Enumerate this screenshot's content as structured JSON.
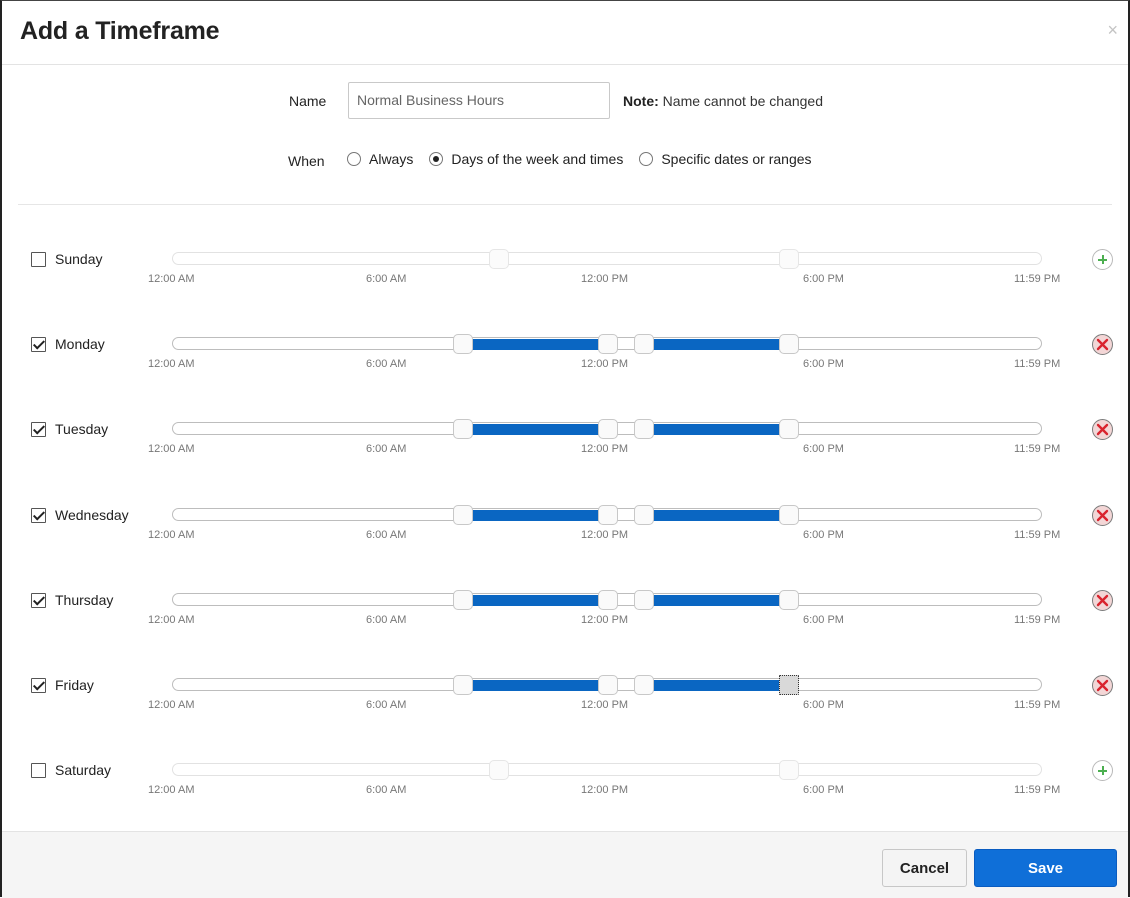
{
  "dialog": {
    "title": "Add a Timeframe",
    "close_glyph": "×"
  },
  "form": {
    "name_label": "Name",
    "name_value": "Normal Business Hours",
    "note_bold": "Note:",
    "note_text": " Name cannot be changed",
    "when_label": "When",
    "when_options": [
      {
        "label": "Always",
        "selected": false
      },
      {
        "label": "Days of the week and times",
        "selected": true
      },
      {
        "label": "Specific dates or ranges",
        "selected": false
      }
    ]
  },
  "tick_labels": [
    "12:00 AM",
    "6:00 AM",
    "12:00 PM",
    "6:00 PM",
    "11:59 PM"
  ],
  "days": [
    {
      "label": "Sunday",
      "checked": false,
      "action_icon": "add-icon",
      "ranges": []
    },
    {
      "label": "Monday",
      "checked": true,
      "action_icon": "remove-icon",
      "ranges": [
        [
          "8:00 AM",
          "12:00 PM"
        ],
        [
          "1:00 PM",
          "5:00 PM"
        ]
      ]
    },
    {
      "label": "Tuesday",
      "checked": true,
      "action_icon": "remove-icon",
      "ranges": [
        [
          "8:00 AM",
          "12:00 PM"
        ],
        [
          "1:00 PM",
          "5:00 PM"
        ]
      ]
    },
    {
      "label": "Wednesday",
      "checked": true,
      "action_icon": "remove-icon",
      "ranges": [
        [
          "8:00 AM",
          "12:00 PM"
        ],
        [
          "1:00 PM",
          "5:00 PM"
        ]
      ]
    },
    {
      "label": "Thursday",
      "checked": true,
      "action_icon": "remove-icon",
      "ranges": [
        [
          "8:00 AM",
          "12:00 PM"
        ],
        [
          "1:00 PM",
          "5:00 PM"
        ]
      ]
    },
    {
      "label": "Friday",
      "checked": true,
      "action_icon": "remove-icon",
      "ranges": [
        [
          "8:00 AM",
          "12:00 PM"
        ],
        [
          "1:00 PM",
          "5:00 PM"
        ]
      ]
    },
    {
      "label": "Saturday",
      "checked": false,
      "action_icon": "add-icon",
      "ranges": []
    }
  ],
  "footer": {
    "cancel_label": "Cancel",
    "save_label": "Save"
  },
  "colors": {
    "range_fill": "#0a66c2",
    "save_button": "#0f6fd8",
    "add_icon": "#4caf50",
    "remove_icon": "#d9232d"
  }
}
